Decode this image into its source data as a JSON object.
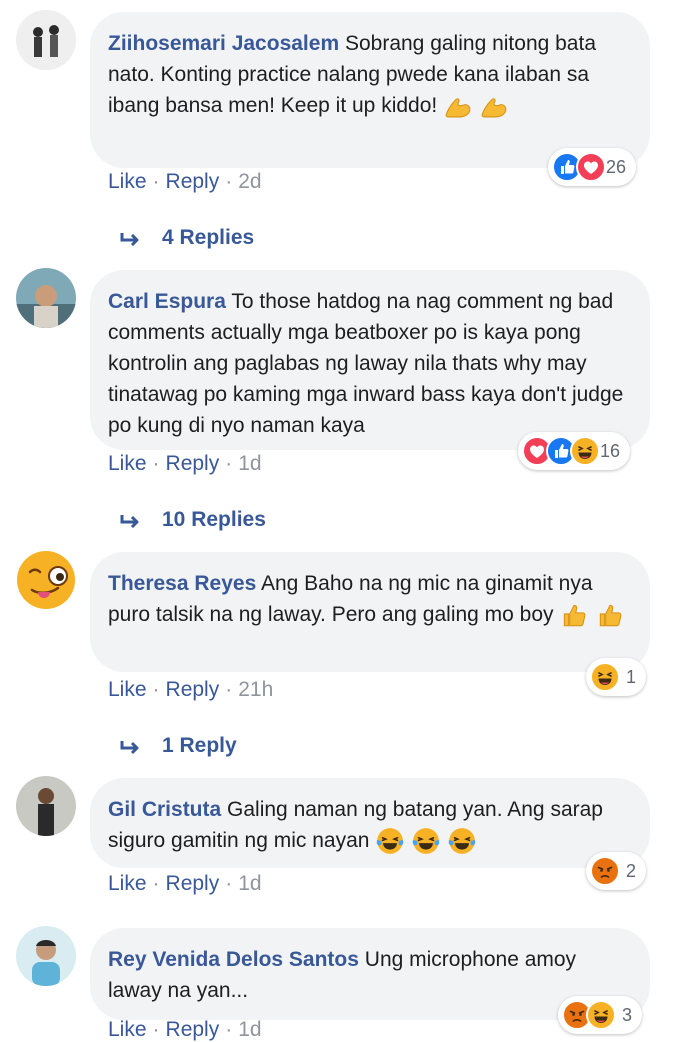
{
  "actions": {
    "like": "Like",
    "reply": "Reply",
    "sep": "·"
  },
  "comments": [
    {
      "author": "Ziihosemari Jacosalem",
      "text": "Sobrang galing nitong bata nato. Konting practice nalang pwede kana ilaban sa ibang bansa men! Keep it up kiddo!",
      "emojis": [
        "flexed-biceps",
        "flexed-biceps"
      ],
      "reactions": [
        "like",
        "love"
      ],
      "reaction_count": "26",
      "time": "2d",
      "replies": "4 Replies"
    },
    {
      "author": "Carl Espura",
      "text": "To those hatdog na nag comment ng bad comments actually mga beatboxer po is kaya pong kontrolin ang paglabas ng laway nila thats why may tinatawag po kaming mga inward bass kaya don't judge po kung di nyo naman kaya",
      "emojis": [],
      "reactions": [
        "love",
        "like",
        "haha"
      ],
      "reaction_count": "16",
      "time": "1d",
      "replies": "10 Replies"
    },
    {
      "author": "Theresa Reyes",
      "text": "Ang Baho na ng mic na ginamit nya puro talsik na ng laway. Pero ang galing mo boy",
      "emojis": [
        "thumbs-up",
        "thumbs-up"
      ],
      "reactions": [
        "haha"
      ],
      "reaction_count": "1",
      "time": "21h",
      "replies": "1 Reply"
    },
    {
      "author": "Gil Cristuta",
      "text": "Galing naman ng batang yan. Ang sarap siguro gamitin ng mic nayan",
      "emojis": [
        "tears-of-joy",
        "tears-of-joy",
        "tears-of-joy"
      ],
      "reactions": [
        "angry"
      ],
      "reaction_count": "2",
      "time": "1d",
      "replies": ""
    },
    {
      "author": "Rey Venida Delos Santos",
      "text": "Ung microphone amoy laway na yan...",
      "emojis": [],
      "reactions": [
        "angry",
        "haha"
      ],
      "reaction_count": "3",
      "time": "1d",
      "replies": ""
    }
  ]
}
